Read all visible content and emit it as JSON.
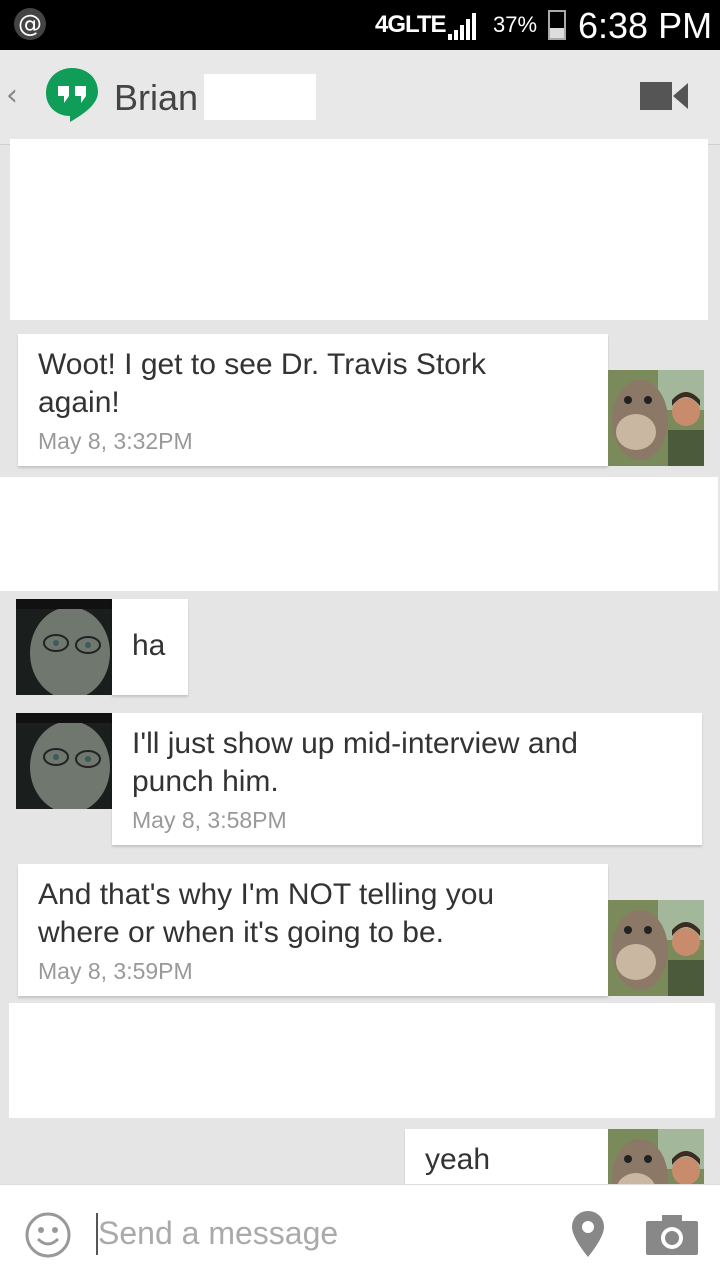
{
  "status_bar": {
    "notification": "@",
    "network": "4GLTE",
    "battery_pct": "37%",
    "battery_level": 0.37,
    "time": "6:38 PM"
  },
  "header": {
    "back_icon": "chevron-left-icon",
    "app_icon": "hangouts-icon",
    "contact_name": "Brian",
    "video_icon": "video-camera-icon"
  },
  "messages": [
    {
      "sender": "other",
      "text_lines": [
        "Woot! I get to see Dr. Travis Stork",
        "again!"
      ],
      "timestamp": "May 8, 3:32PM"
    },
    {
      "sender": "me",
      "text_lines": [
        "ha"
      ],
      "timestamp": ""
    },
    {
      "sender": "me",
      "text_lines": [
        "I'll just show up mid-interview and",
        "punch him."
      ],
      "timestamp": "May 8, 3:58PM"
    },
    {
      "sender": "other",
      "text_lines": [
        "And that's why I'm NOT telling you",
        "where or when it's going to be."
      ],
      "timestamp": "May 8, 3:59PM"
    },
    {
      "sender": "other",
      "text_lines": [
        "yeah"
      ],
      "timestamp": ""
    }
  ],
  "composer": {
    "placeholder": "Send a message",
    "emoji_icon": "emoji-icon",
    "location_icon": "location-pin-icon",
    "camera_icon": "camera-icon"
  },
  "colors": {
    "hangouts_green": "#0f9d58",
    "background": "#e5e5e5",
    "bubble": "#ffffff",
    "timestamp": "#999999"
  }
}
